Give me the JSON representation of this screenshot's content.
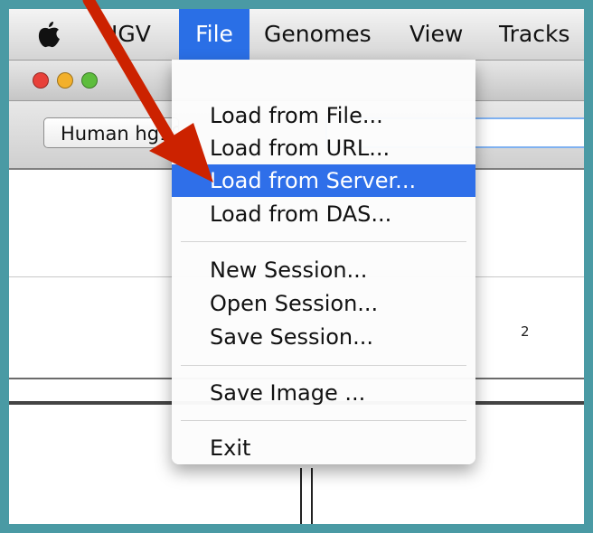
{
  "menubar": {
    "app_name": "IGV",
    "menus": [
      {
        "label": "File",
        "active": true
      },
      {
        "label": "Genomes"
      },
      {
        "label": "View"
      },
      {
        "label": "Tracks"
      }
    ]
  },
  "toolbar": {
    "genome_value": "Human hg19"
  },
  "data_panel": {
    "ruler_value": "2"
  },
  "file_menu": {
    "items": [
      {
        "label": "Load from File..."
      },
      {
        "label": "Load from URL..."
      },
      {
        "label": "Load from Server...",
        "selected": true
      },
      {
        "label": "Load from DAS..."
      },
      {
        "label": "New Session..."
      },
      {
        "label": "Open Session..."
      },
      {
        "label": "Save Session..."
      },
      {
        "label": "Save Image ..."
      },
      {
        "label": "Exit"
      }
    ]
  },
  "colors": {
    "frame": "#4a9aa4",
    "highlight": "#2f6fe9",
    "arrow": "#cc2200"
  }
}
